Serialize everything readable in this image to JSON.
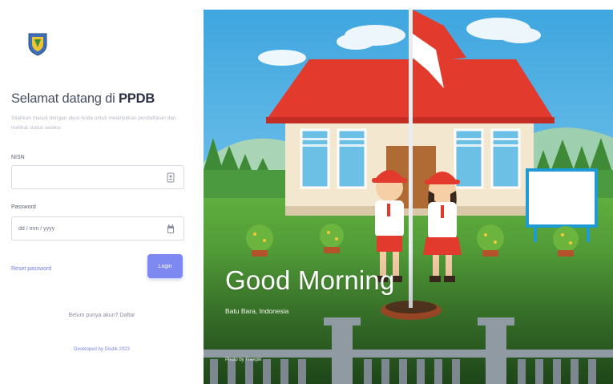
{
  "login": {
    "welcome_prefix": "Selamat datang di ",
    "app_name": "PPDB",
    "subtitle": "Silahkan masuk dengan akun Anda untuk melanjutkan pendaftaran dan melihat status seleksi",
    "nisn_label": "NISN",
    "nisn_value": "",
    "nisn_icon": "id-card-icon",
    "password_label": "Password",
    "password_value": "dd / mm / yyyy",
    "password_icon": "calendar-icon",
    "reset_link": "Reset password",
    "login_button": "Login",
    "register_prompt": "Belum punya akun? Daftar",
    "footer_credit": "Developed by Disdik 2023"
  },
  "hero": {
    "greeting": "Good Morning",
    "location": "Batu Bara, Indonesia",
    "photo_credit": "Photo by Freepik"
  },
  "colors": {
    "primary": "#7d88f0",
    "sky": "#5bb7e6",
    "grass": "#4f9a3a",
    "roof": "#e23b2e",
    "wall": "#f3e7cf"
  }
}
